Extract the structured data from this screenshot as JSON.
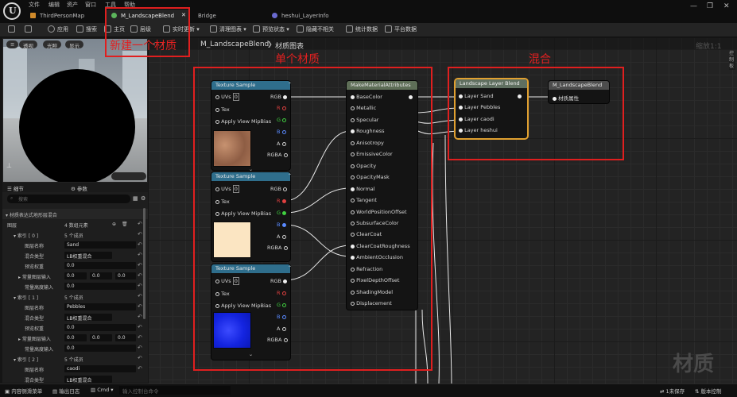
{
  "menu": {
    "items": [
      "文件",
      "编辑",
      "资产",
      "窗口",
      "工具",
      "帮助"
    ]
  },
  "tabs": [
    {
      "label": "ThirdPersonMap",
      "icon": "map-icon",
      "active": false
    },
    {
      "label": "M_LandscapeBlend",
      "icon": "material-icon",
      "active": true
    },
    {
      "label": "Bridge",
      "icon": "bridge-icon",
      "active": false
    },
    {
      "label": "heshui_LayerInfo",
      "icon": "layerinfo-icon",
      "active": false
    }
  ],
  "toolbar": {
    "apply": "应用",
    "search": "搜索",
    "home": "主页",
    "hierarchy": "层级",
    "live_update": "实时更新",
    "clean_graph": "清理图表",
    "preview_state": "预览状态",
    "hide_unrelated": "隐藏不相关",
    "stats": "统计数据",
    "platform_stats": "平台数据"
  },
  "breadcrumb": {
    "material": "M_LandscapeBlend",
    "separator": "❯",
    "graph": "材质图表"
  },
  "zoom_label": "缩放1:1",
  "side_tab": "控制板",
  "viewport": {
    "btn_perspective": "透视",
    "btn_lit": "光照",
    "btn_show": "显示"
  },
  "details": {
    "tab_details": "细节",
    "tab_params": "参数",
    "search_placeholder": "搜索",
    "section": "材质表达式地形层混合",
    "layers_label": "图层",
    "layers_value": "4 数组元素",
    "index0": "索引 [ 0 ]",
    "index0_count": "5 个成员",
    "layer_name_label": "图层名称",
    "layer0_name": "Sand",
    "blend_type_label": "混合类型",
    "blend_type_value": "LB权重混合",
    "preview_weight_label": "预览权重",
    "preview_weight_value": "0.0",
    "const_layer_input_label": "常量图层输入",
    "const_val": "0.0",
    "const_height_input_label": "常量高度输入",
    "index1": "索引 [ 1 ]",
    "index1_count": "5 个成员",
    "layer1_name": "Pebbles",
    "index2": "索引 [ 2 ]",
    "index2_count": "5 个成员",
    "layer2_name": "caodi"
  },
  "nodes": {
    "tex1": {
      "title": "Texture Sample"
    },
    "tex2": {
      "title": "Texture Sample"
    },
    "tex3": {
      "title": "Texture Sample"
    },
    "tex_in": {
      "uvs": "UVs",
      "uvs_val": "0",
      "tex": "Tex",
      "apply_mip": "Apply View MipBias"
    },
    "tex_out": {
      "rgb": "RGB",
      "r": "R",
      "g": "G",
      "b": "B",
      "a": "A",
      "rgba": "RGBA"
    },
    "mma": {
      "title": "MakeMaterialAttributes",
      "pins": [
        "BaseColor",
        "Metallic",
        "Specular",
        "Roughness",
        "Anisotropy",
        "EmissiveColor",
        "Opacity",
        "OpacityMask",
        "Normal",
        "Tangent",
        "WorldPositionOffset",
        "SubsurfaceColor",
        "ClearCoat",
        "ClearCoatRoughness",
        "AmbientOcclusion",
        "Refraction",
        "PixelDepthOffset",
        "ShadingModel",
        "Displacement"
      ]
    },
    "llb": {
      "title": "Landscape Layer Blend",
      "pins": [
        "Layer Sand",
        "Layer Pebbles",
        "Layer caodi",
        "Layer heshui"
      ]
    },
    "result": {
      "title": "M_LandscapeBlend",
      "pin": "材质属性"
    }
  },
  "annotations": {
    "new_material": "新建一个材质",
    "single_material": "单个材质",
    "blend": "混合"
  },
  "watermark": "材质",
  "statusbar": {
    "content_drawer": "内容侧滑菜单",
    "output_log": "输出日志",
    "cmd": "Cmd",
    "console_placeholder": "输入控制台命令",
    "unsaved": "1未保存",
    "source_control": "版本控制"
  },
  "colors": {
    "red_annotation": "#e01f1f",
    "tex_header": "#2f6e8c",
    "mma_header": "#5e6e57",
    "llb_header": "#5f6f60",
    "result_header": "#4d4d4d",
    "selection": "#e0a030"
  }
}
